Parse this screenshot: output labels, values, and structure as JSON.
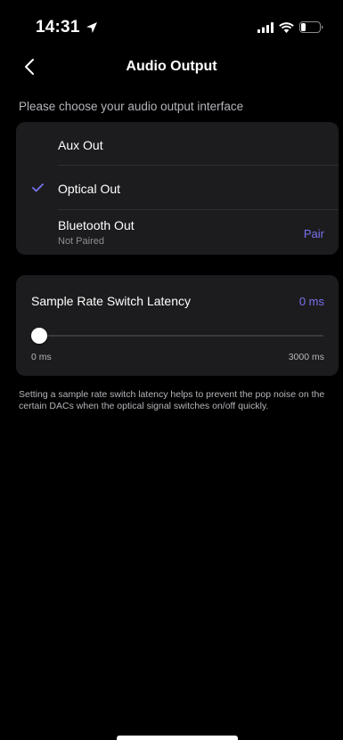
{
  "status_bar": {
    "time": "14:31",
    "location_icon": "location-arrow-icon",
    "signal_icon": "cellular-signal-icon",
    "wifi_icon": "wifi-icon",
    "battery_icon": "battery-icon"
  },
  "nav": {
    "back_icon": "chevron-left-icon",
    "title": "Audio Output"
  },
  "output": {
    "caption": "Please choose your audio output interface",
    "options": [
      {
        "label": "Aux Out",
        "selected": false
      },
      {
        "label": "Optical Out",
        "selected": true
      },
      {
        "label": "Bluetooth Out",
        "sublabel": "Not Paired",
        "action": "Pair",
        "selected": false
      }
    ]
  },
  "latency": {
    "title": "Sample Rate Switch Latency",
    "value_label": "0 ms",
    "value": 0,
    "min": 0,
    "max": 3000,
    "min_label": "0 ms",
    "max_label": "3000 ms"
  },
  "note": "Setting a sample rate switch latency helps to prevent the pop noise on the certain DACs when the optical signal switches on/off quickly.",
  "colors": {
    "accent": "#7a72ee",
    "background": "#000000",
    "card": "#1c1c1e",
    "secondary_text": "#b5b5bb"
  }
}
